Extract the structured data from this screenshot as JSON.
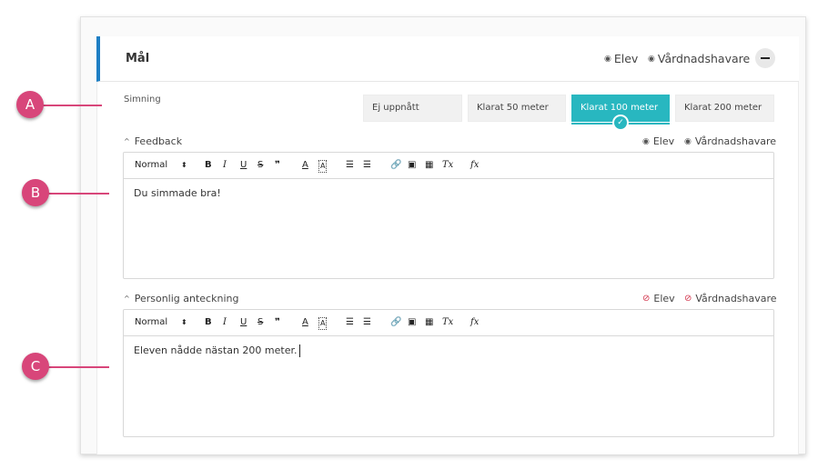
{
  "header": {
    "title": "Mål",
    "visibility": [
      "Elev",
      "Vårdnadshavare"
    ]
  },
  "simning": {
    "label": "Simning",
    "options": [
      "Ej uppnått",
      "Klarat 50 meter",
      "Klarat 100 meter",
      "Klarat 200 meter"
    ],
    "selected": "Klarat 100 meter"
  },
  "feedback": {
    "label": "Feedback",
    "visibility": [
      "Elev",
      "Vårdnadshavare"
    ],
    "toolbar": {
      "format": "Normal",
      "bold": "B",
      "italic": "I",
      "underline": "U",
      "strike": "S",
      "quote": "❞",
      "color": "A",
      "highlight": "A",
      "clear": "Tx",
      "formula": "fx"
    },
    "text": "Du simmade bra!"
  },
  "personal": {
    "label": "Personlig anteckning",
    "visibility": [
      "Elev",
      "Vårdnadshavare"
    ],
    "toolbar": {
      "format": "Normal",
      "bold": "B",
      "italic": "I",
      "underline": "U",
      "strike": "S",
      "quote": "❞",
      "color": "A",
      "highlight": "A",
      "clear": "Tx",
      "formula": "fx"
    },
    "text": "Eleven nådde nästan 200 meter."
  },
  "markers": [
    "A",
    "B",
    "C"
  ],
  "colors": {
    "accent": "#28b7c0",
    "marker": "#d8467a",
    "header_bar": "#1e7fc4",
    "hidden_eye": "#d2334b"
  }
}
